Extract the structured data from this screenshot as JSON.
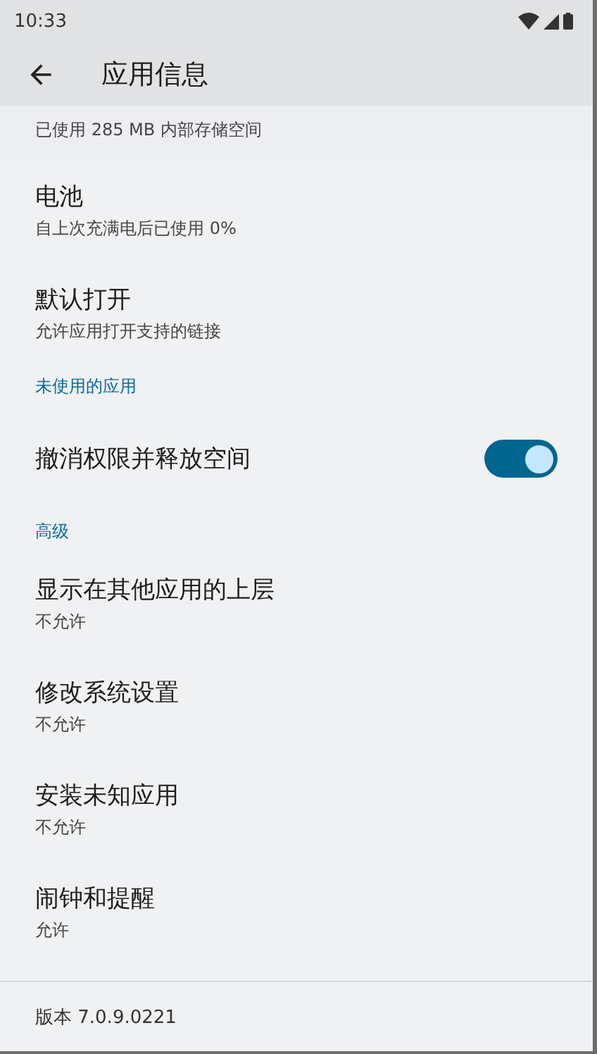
{
  "status_bar": {
    "time": "10:33"
  },
  "app_bar": {
    "title": "应用信息"
  },
  "partial_item": {
    "subtitle": "已使用 285 MB 内部存储空间"
  },
  "sections": [
    {
      "items": [
        {
          "kind": "text",
          "title": "电池",
          "subtitle": "自上次充满电后已使用 0%"
        },
        {
          "kind": "text",
          "title": "默认打开",
          "subtitle": "允许应用打开支持的链接"
        }
      ]
    },
    {
      "header": "未使用的应用",
      "items": [
        {
          "kind": "switch",
          "title": "撤消权限并释放空间",
          "on": true
        }
      ]
    },
    {
      "header": "高级",
      "items": [
        {
          "kind": "text",
          "title": "显示在其他应用的上层",
          "subtitle": "不允许"
        },
        {
          "kind": "text",
          "title": "修改系统设置",
          "subtitle": "不允许"
        },
        {
          "kind": "text",
          "title": "安装未知应用",
          "subtitle": "不允许"
        },
        {
          "kind": "text",
          "title": "闹钟和提醒",
          "subtitle": "允许"
        }
      ]
    }
  ],
  "footer": {
    "version": "版本 7.0.9.0221"
  }
}
